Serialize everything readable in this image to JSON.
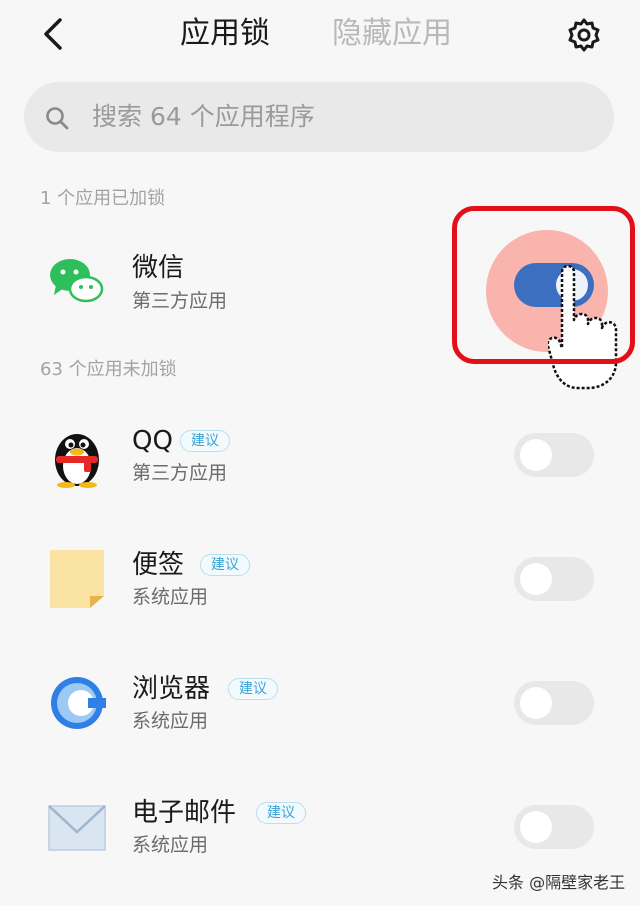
{
  "header": {
    "tab_active": "应用锁",
    "tab_inactive": "隐藏应用",
    "back_icon": "back-arrow-icon",
    "settings_icon": "gear-icon"
  },
  "search": {
    "placeholder": "搜索 64 个应用程序",
    "icon": "search-icon"
  },
  "locked_section": {
    "label": "1 个应用已加锁",
    "apps": [
      {
        "name": "微信",
        "type": "第三方应用",
        "locked": true,
        "icon": "wechat-icon"
      }
    ]
  },
  "unlocked_section": {
    "label": "63 个应用未加锁",
    "apps": [
      {
        "name": "QQ",
        "badge": "建议",
        "type": "第三方应用",
        "locked": false,
        "icon": "qq-penguin-icon"
      },
      {
        "name": "便签",
        "badge": "建议",
        "type": "系统应用",
        "locked": false,
        "icon": "notes-icon"
      },
      {
        "name": "浏览器",
        "badge": "建议",
        "type": "系统应用",
        "locked": false,
        "icon": "browser-icon"
      },
      {
        "name": "电子邮件",
        "badge": "建议",
        "type": "系统应用",
        "locked": false,
        "icon": "email-icon"
      }
    ]
  },
  "overlay": {
    "highlight_color": "#e3101a",
    "pointer_icon": "hand-pointer-icon"
  },
  "watermark": "头条 @隔壁家老王",
  "colors": {
    "toggle_on": "#3d6fc0",
    "toggle_off": "#e8e8e8",
    "badge": "#3aa4d6"
  }
}
